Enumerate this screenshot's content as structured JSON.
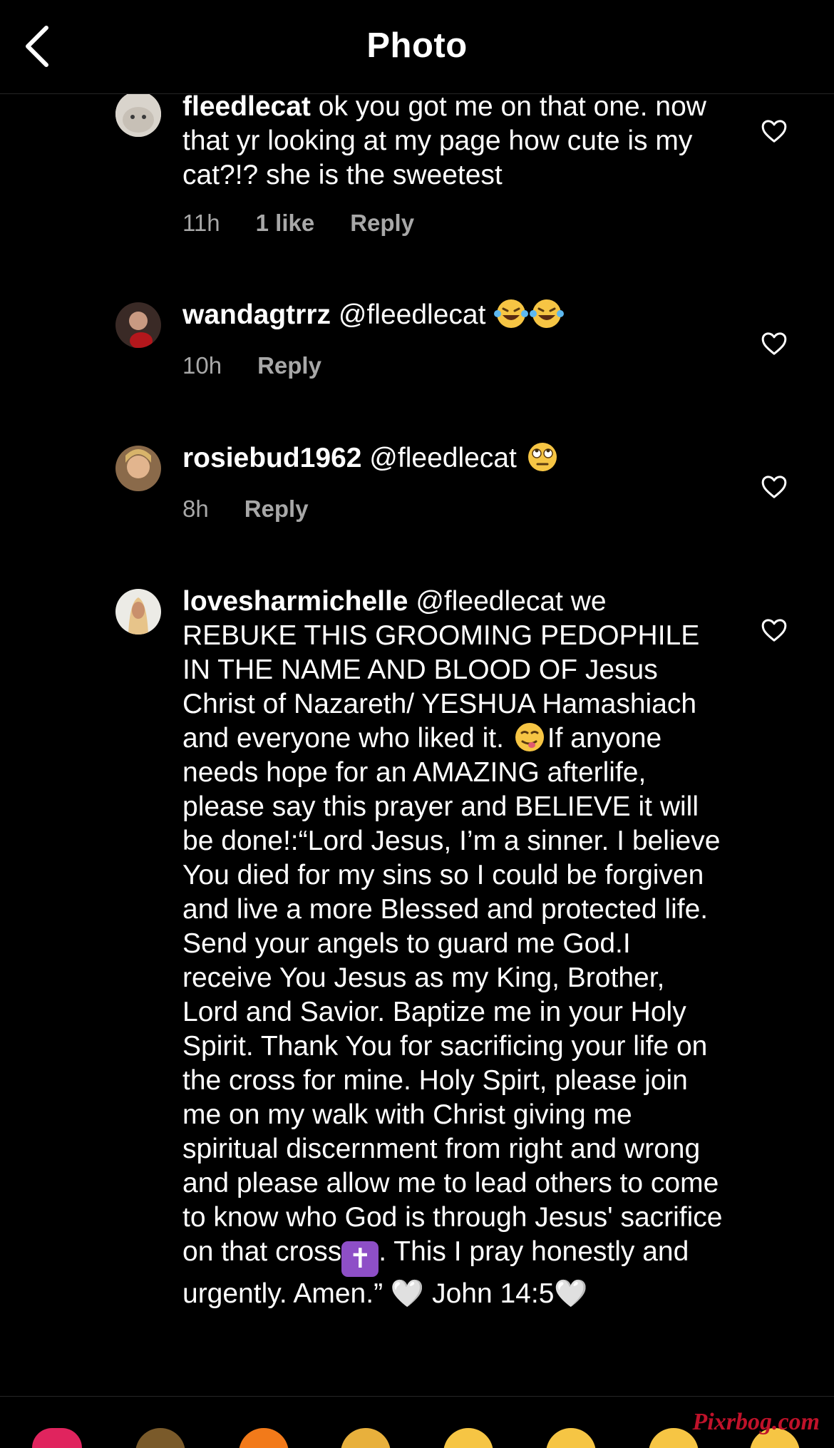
{
  "header": {
    "title": "Photo",
    "back_icon": "chevron-left-icon"
  },
  "comments": [
    {
      "username": "fleedlecat",
      "text": " ok you got me on that one. now that yr looking at my page how cute is my cat?!? she is the sweetest",
      "time": "11h",
      "likes": "1 like",
      "reply": "Reply"
    },
    {
      "username": "wandagtrrz",
      "text": " @fleedlecat ",
      "time": "10h",
      "reply": "Reply"
    },
    {
      "username": "rosiebud1962",
      "text": " @fleedlecat ",
      "time": "8h",
      "reply": "Reply"
    },
    {
      "username": "lovesharmichelle",
      "text_1": " @fleedlecat we REBUKE THIS GROOMING PEDOPHILE IN THE NAME AND BLOOD OF Jesus Christ of Nazareth/ YESHUA Hamashiach and everyone who liked it. ",
      "text_2": "If anyone  needs hope for an AMAZING afterlife,  please say this prayer and BELIEVE it will be done!:“Lord Jesus, I’m a sinner. I believe You died for my sins so I could be forgiven and live a more Blessed and protected life. Send your angels to guard me God.I receive You Jesus as my King, Brother, Lord and Savior. Baptize me in your Holy Spirit.  Thank You for sacrificing your life on the cross for mine. Holy Spirt, please join me on my walk with Christ giving me spiritual discernment from right and wrong and please allow me to lead others to come to know who God is through Jesus' sacrifice on that cross",
      "cross": "✝",
      "text_3": ". This I pray honestly and urgently. Amen.” ",
      "heart_1": "🤍",
      "text_4": " John 14:5",
      "heart_2": "🤍"
    }
  ],
  "watermark": "Pixrbog.com",
  "colors": {
    "background": "#000000",
    "secondary_text": "#a8a8a8",
    "divider": "#262626",
    "cross_emoji": "#8e4fc7"
  }
}
